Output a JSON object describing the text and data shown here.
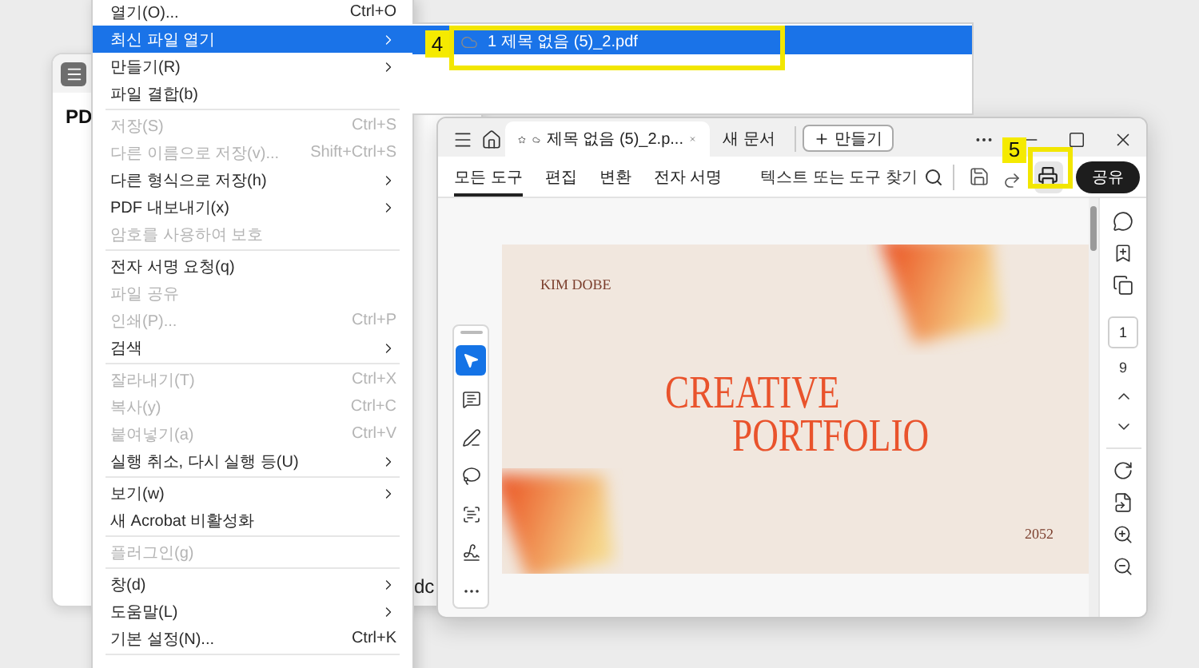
{
  "back_window": {
    "heading": "PD",
    "fragment": "dc"
  },
  "file_menu": {
    "items": [
      {
        "kind": "item",
        "label": "열기(O)...",
        "shortcut": "Ctrl+O",
        "submenu": false,
        "disabled": false,
        "selected": false
      },
      {
        "kind": "item",
        "label": "최신 파일 열기",
        "submenu": true,
        "disabled": false,
        "selected": true
      },
      {
        "kind": "item",
        "label": "만들기(R)",
        "submenu": true,
        "disabled": false,
        "selected": false
      },
      {
        "kind": "item",
        "label": "파일 결합(b)",
        "submenu": false,
        "disabled": false,
        "selected": false
      },
      {
        "kind": "separator"
      },
      {
        "kind": "item",
        "label": "저장(S)",
        "shortcut": "Ctrl+S",
        "submenu": false,
        "disabled": true,
        "selected": false
      },
      {
        "kind": "item",
        "label": "다른 이름으로 저장(v)...",
        "shortcut": "Shift+Ctrl+S",
        "submenu": false,
        "disabled": true,
        "selected": false
      },
      {
        "kind": "item",
        "label": "다른 형식으로 저장(h)",
        "submenu": true,
        "disabled": false,
        "selected": false
      },
      {
        "kind": "item",
        "label": "PDF 내보내기(x)",
        "submenu": true,
        "disabled": false,
        "selected": false
      },
      {
        "kind": "item",
        "label": "암호를 사용하여 보호",
        "submenu": false,
        "disabled": true,
        "selected": false
      },
      {
        "kind": "separator"
      },
      {
        "kind": "item",
        "label": "전자 서명 요청(q)",
        "submenu": false,
        "disabled": false,
        "selected": false
      },
      {
        "kind": "item",
        "label": "파일 공유",
        "submenu": false,
        "disabled": true,
        "selected": false
      },
      {
        "kind": "item",
        "label": "인쇄(P)...",
        "shortcut": "Ctrl+P",
        "submenu": false,
        "disabled": true,
        "selected": false
      },
      {
        "kind": "item",
        "label": "검색",
        "submenu": true,
        "disabled": false,
        "selected": false
      },
      {
        "kind": "separator"
      },
      {
        "kind": "item",
        "label": "잘라내기(T)",
        "shortcut": "Ctrl+X",
        "submenu": false,
        "disabled": true,
        "selected": false
      },
      {
        "kind": "item",
        "label": "복사(y)",
        "shortcut": "Ctrl+C",
        "submenu": false,
        "disabled": true,
        "selected": false
      },
      {
        "kind": "item",
        "label": "붙여넣기(a)",
        "shortcut": "Ctrl+V",
        "submenu": false,
        "disabled": true,
        "selected": false
      },
      {
        "kind": "item",
        "label": "실행 취소, 다시 실행 등(U)",
        "submenu": true,
        "disabled": false,
        "selected": false
      },
      {
        "kind": "separator"
      },
      {
        "kind": "item",
        "label": "보기(w)",
        "submenu": true,
        "disabled": false,
        "selected": false
      },
      {
        "kind": "item",
        "label": "새 Acrobat 비활성화",
        "submenu": false,
        "disabled": false,
        "selected": false
      },
      {
        "kind": "separator"
      },
      {
        "kind": "item",
        "label": "플러그인(g)",
        "submenu": false,
        "disabled": true,
        "selected": false
      },
      {
        "kind": "separator"
      },
      {
        "kind": "item",
        "label": "창(d)",
        "submenu": true,
        "disabled": false,
        "selected": false
      },
      {
        "kind": "item",
        "label": "도움말(L)",
        "submenu": true,
        "disabled": false,
        "selected": false
      },
      {
        "kind": "item",
        "label": "기본 설정(N)...",
        "shortcut": "Ctrl+K",
        "submenu": false,
        "disabled": false,
        "selected": false
      },
      {
        "kind": "separator"
      }
    ]
  },
  "recent_submenu": {
    "items": [
      {
        "label": "1 제목 없음 (5)_2.pdf",
        "selected": true
      }
    ]
  },
  "callouts": [
    {
      "label": "4"
    },
    {
      "label": "5"
    }
  ],
  "app_window": {
    "tabs": [
      {
        "label": "제목 없음 (5)_2.p...",
        "selected": true
      },
      {
        "label": "새 문서",
        "selected": false
      }
    ],
    "create_button": "만들기",
    "tool_tabs": [
      {
        "label": "모든 도구",
        "selected": true
      },
      {
        "label": "편집",
        "selected": false
      },
      {
        "label": "변환",
        "selected": false
      },
      {
        "label": "전자 서명",
        "selected": false
      }
    ],
    "search": {
      "placeholder": "텍스트 또는 도구 찾기"
    },
    "share_button": "공유",
    "tools": [
      {
        "kind": "select",
        "selected": true
      },
      {
        "kind": "comment",
        "selected": false
      },
      {
        "kind": "draw",
        "selected": false
      },
      {
        "kind": "lasso",
        "selected": false
      },
      {
        "kind": "text",
        "selected": false
      },
      {
        "kind": "sign",
        "selected": false
      },
      {
        "kind": "more",
        "selected": false
      }
    ],
    "page": {
      "author": "KIM DOBE",
      "title_lines": [
        "CREATIVE",
        "PORTFOLIO"
      ],
      "year": "2052"
    },
    "page_nav": {
      "current": "1",
      "total": "9"
    }
  }
}
